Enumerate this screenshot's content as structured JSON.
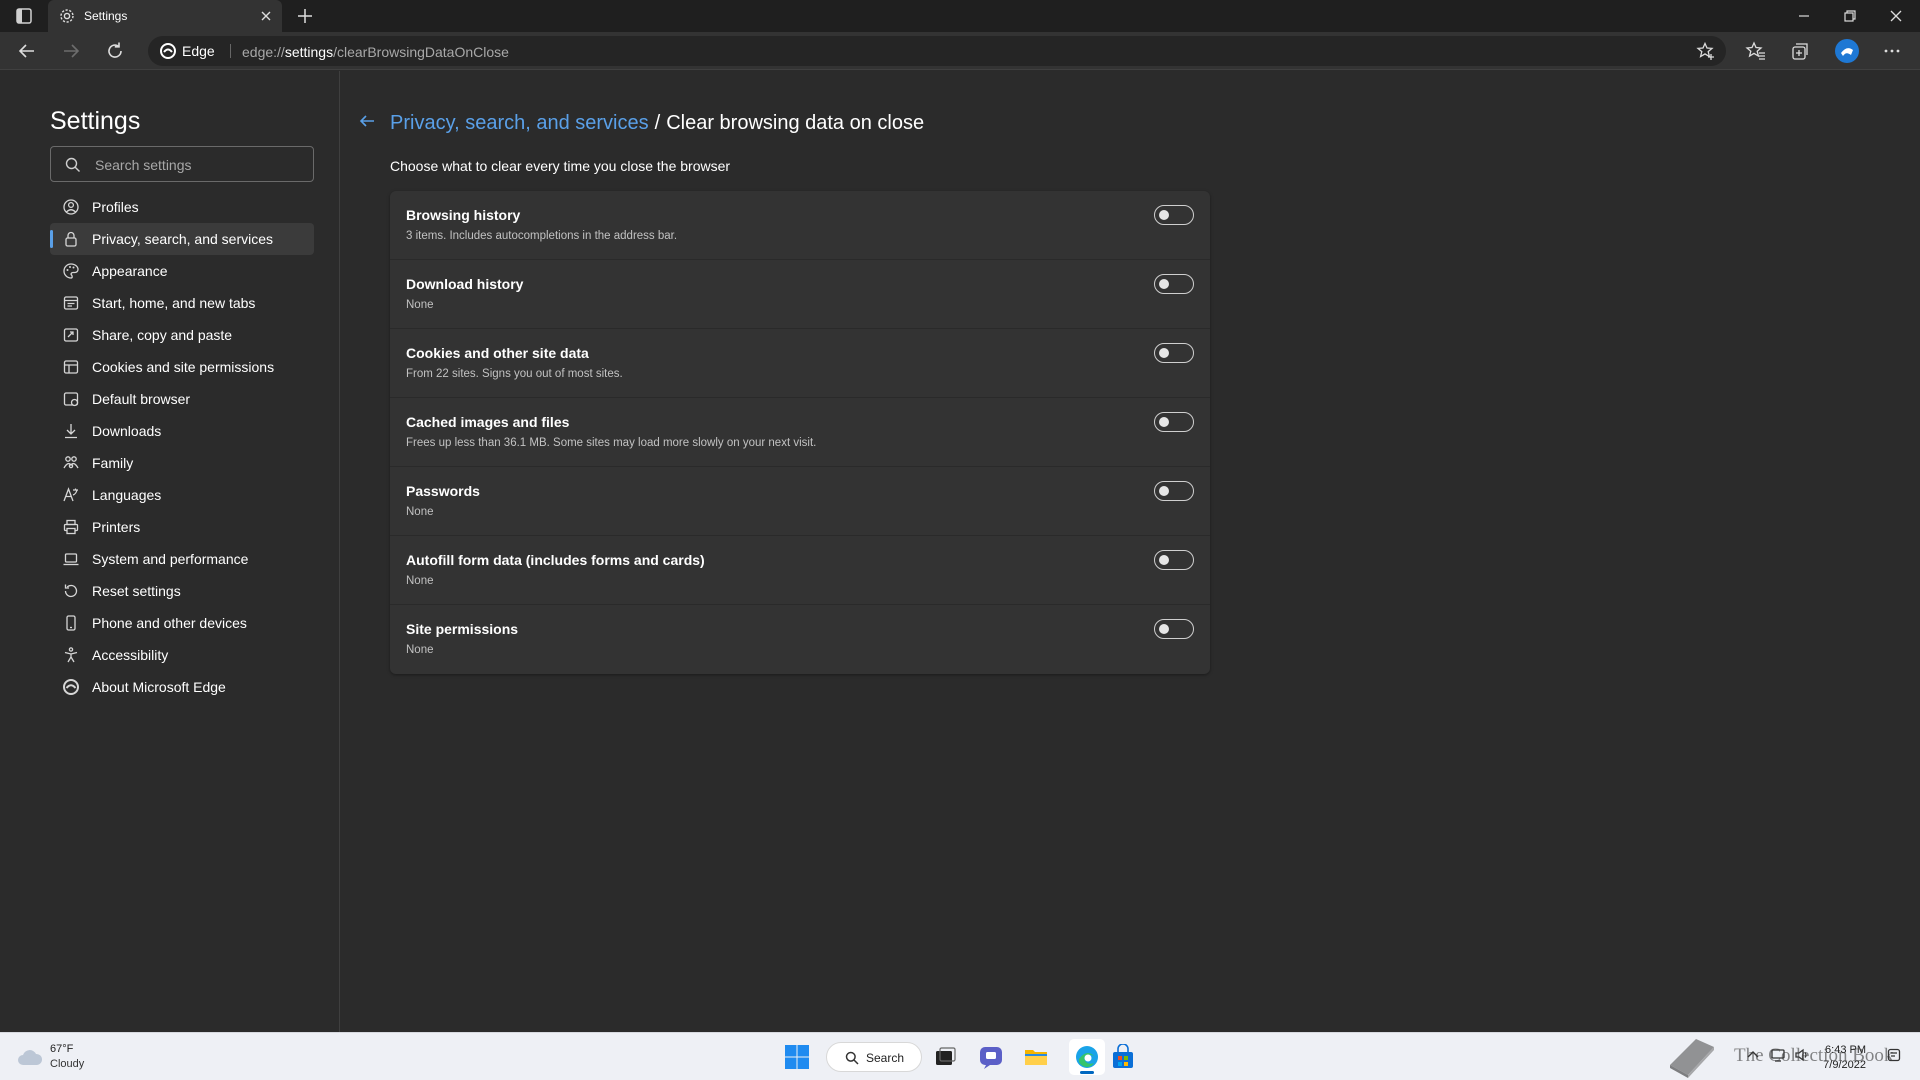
{
  "window": {
    "tab_title": "Settings",
    "address_site": "Edge",
    "url_prefix": "edge://",
    "url_host": "settings",
    "url_path": "/clearBrowsingDataOnClose"
  },
  "sidebar": {
    "title": "Settings",
    "search_placeholder": "Search settings",
    "items": [
      {
        "label": "Profiles",
        "icon": "profile-icon"
      },
      {
        "label": "Privacy, search, and services",
        "icon": "lock-icon",
        "active": true
      },
      {
        "label": "Appearance",
        "icon": "palette-icon"
      },
      {
        "label": "Start, home, and new tabs",
        "icon": "home-tabs-icon"
      },
      {
        "label": "Share, copy and paste",
        "icon": "share-icon"
      },
      {
        "label": "Cookies and site permissions",
        "icon": "cookie-icon"
      },
      {
        "label": "Default browser",
        "icon": "browser-icon"
      },
      {
        "label": "Downloads",
        "icon": "download-icon"
      },
      {
        "label": "Family",
        "icon": "family-icon"
      },
      {
        "label": "Languages",
        "icon": "language-icon"
      },
      {
        "label": "Printers",
        "icon": "printer-icon"
      },
      {
        "label": "System and performance",
        "icon": "laptop-icon"
      },
      {
        "label": "Reset settings",
        "icon": "reset-icon"
      },
      {
        "label": "Phone and other devices",
        "icon": "phone-icon"
      },
      {
        "label": "Accessibility",
        "icon": "accessibility-icon"
      },
      {
        "label": "About Microsoft Edge",
        "icon": "edge-logo-icon"
      }
    ]
  },
  "main": {
    "breadcrumb_parent": "Privacy, search, and services",
    "breadcrumb_separator": "/",
    "breadcrumb_current": "Clear browsing data on close",
    "intro": "Choose what to clear every time you close the browser",
    "options": [
      {
        "title": "Browsing history",
        "subtitle": "3 items. Includes autocompletions in the address bar.",
        "enabled": false
      },
      {
        "title": "Download history",
        "subtitle": "None",
        "enabled": false
      },
      {
        "title": "Cookies and other site data",
        "subtitle": "From 22 sites. Signs you out of most sites.",
        "enabled": false
      },
      {
        "title": "Cached images and files",
        "subtitle": "Frees up less than 36.1 MB. Some sites may load more slowly on your next visit.",
        "enabled": false
      },
      {
        "title": "Passwords",
        "subtitle": "None",
        "enabled": false
      },
      {
        "title": "Autofill form data (includes forms and cards)",
        "subtitle": "None",
        "enabled": false
      },
      {
        "title": "Site permissions",
        "subtitle": "None",
        "enabled": false
      }
    ]
  },
  "taskbar": {
    "weather_temp": "67°F",
    "weather_condition": "Cloudy",
    "search_label": "Search",
    "time": "6:43 PM",
    "date": "7/9/2022",
    "watermark": "The Collection Book"
  },
  "colors": {
    "accent": "#5aa0e8",
    "background": "#2b2b2b",
    "card": "#333333",
    "taskbar": "#eef0f5"
  }
}
